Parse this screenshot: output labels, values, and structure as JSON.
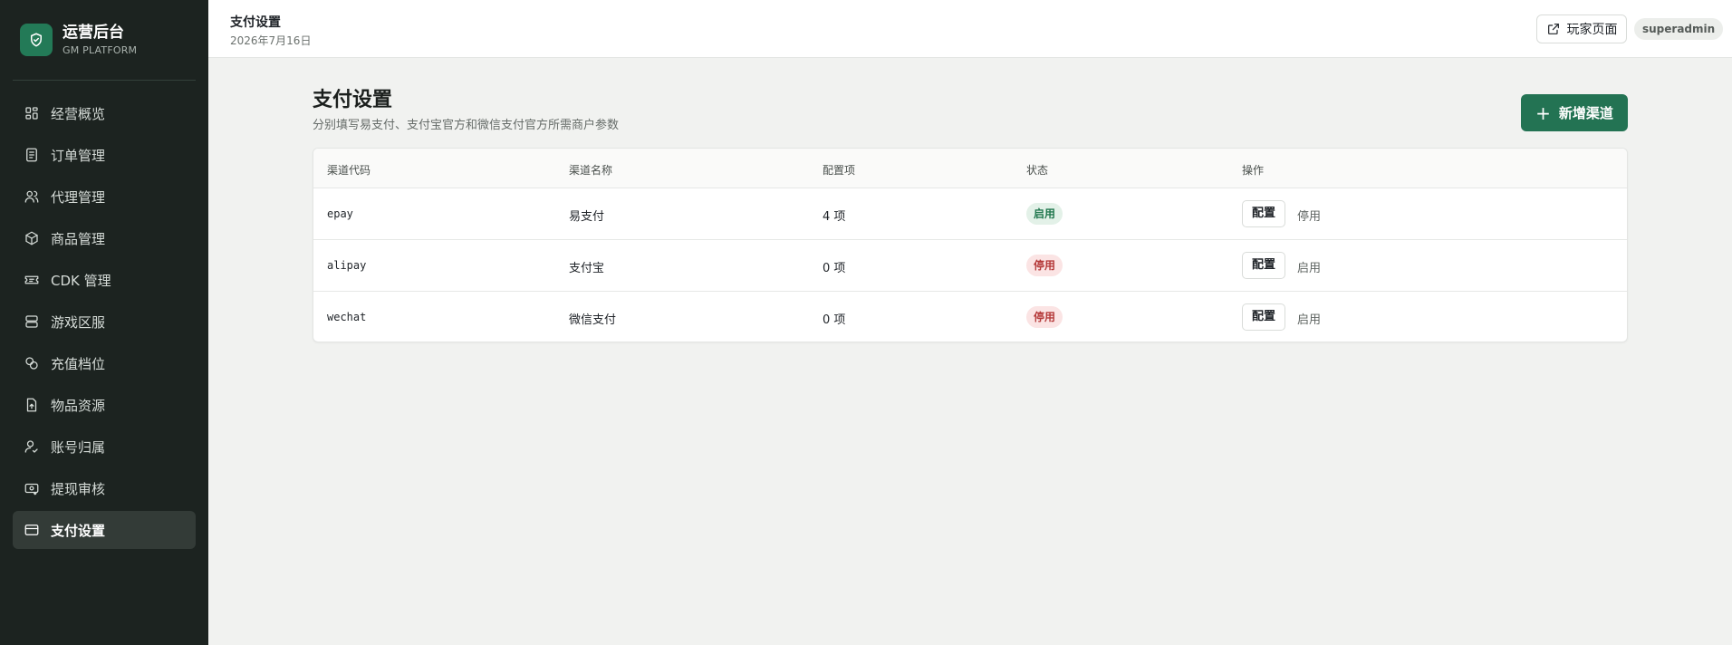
{
  "sidebar": {
    "brand_title": "运营后台",
    "brand_subtitle": "GM PLATFORM",
    "items": [
      {
        "label": "经营概览",
        "icon": "dashboard-icon"
      },
      {
        "label": "订单管理",
        "icon": "document-icon"
      },
      {
        "label": "代理管理",
        "icon": "users-icon"
      },
      {
        "label": "商品管理",
        "icon": "package-icon"
      },
      {
        "label": "CDK 管理",
        "icon": "ticket-icon"
      },
      {
        "label": "游戏区服",
        "icon": "server-icon"
      },
      {
        "label": "充值档位",
        "icon": "coins-icon"
      },
      {
        "label": "物品资源",
        "icon": "file-upload-icon"
      },
      {
        "label": "账号归属",
        "icon": "user-check-icon"
      },
      {
        "label": "提现审核",
        "icon": "withdraw-icon"
      },
      {
        "label": "支付设置",
        "icon": "card-icon",
        "active": true
      }
    ]
  },
  "header": {
    "title": "支付设置",
    "date": "2026年7月16日",
    "player_page_label": "玩家页面",
    "user": "superadmin"
  },
  "main": {
    "title": "支付设置",
    "subtitle": "分别填写易支付、支付宝官方和微信支付官方所需商户参数",
    "add_button": "新增渠道",
    "columns": [
      "渠道代码",
      "渠道名称",
      "配置项",
      "状态",
      "操作"
    ],
    "rows": [
      {
        "code": "epay",
        "name": "易支付",
        "config": "4 项",
        "status": "启用",
        "enabled": true,
        "config_btn": "配置",
        "toggle": "停用"
      },
      {
        "code": "alipay",
        "name": "支付宝",
        "config": "0 项",
        "status": "停用",
        "enabled": false,
        "config_btn": "配置",
        "toggle": "启用"
      },
      {
        "code": "wechat",
        "name": "微信支付",
        "config": "0 项",
        "status": "停用",
        "enabled": false,
        "config_btn": "配置",
        "toggle": "启用"
      }
    ]
  },
  "colors": {
    "sidebar_bg": "#1c2320",
    "accent": "#237353",
    "status_on": "#22784f",
    "status_off": "#b53a3a"
  }
}
